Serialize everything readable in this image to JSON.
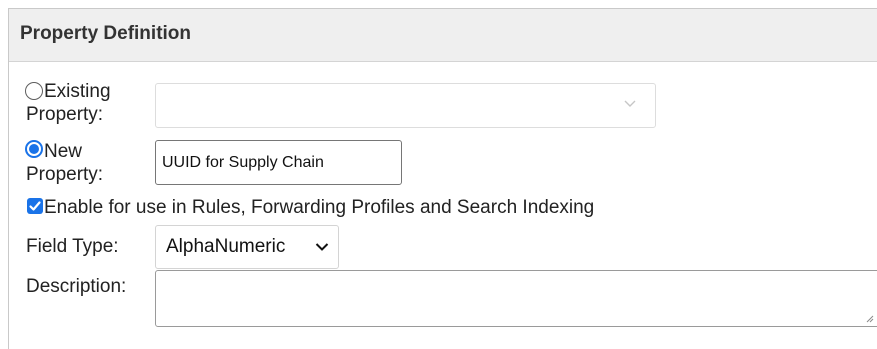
{
  "panel": {
    "title": "Property Definition"
  },
  "form": {
    "existing_property": {
      "label_line1": "Existing",
      "label_line2": "Property:",
      "selected": false,
      "value": ""
    },
    "new_property": {
      "label_line1": "New",
      "label_line2": "Property:",
      "selected": true,
      "value": "UUID for Supply Chain"
    },
    "enable_checkbox": {
      "label": "Enable for use in Rules, Forwarding Profiles and Search Indexing",
      "checked": true
    },
    "field_type": {
      "label": "Field Type:",
      "value": "AlphaNumeric"
    },
    "description": {
      "label": "Description:",
      "value": ""
    }
  },
  "colors": {
    "accent": "#1a73e8",
    "header_bg": "#efefef"
  },
  "icons": {
    "select_chevron": "chevron-down-icon",
    "checkbox_check": "checkmark-icon",
    "resize": "resize-grip-icon"
  }
}
